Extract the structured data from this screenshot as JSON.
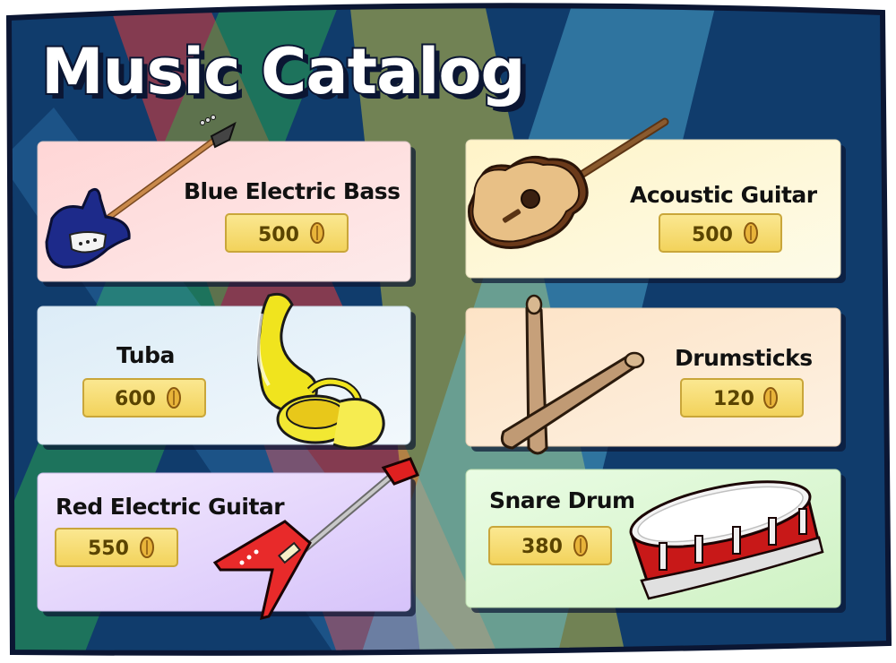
{
  "catalog": {
    "title": "Music Catalog",
    "items": [
      {
        "name": "Blue Electric Bass",
        "price": "500",
        "icon": "blue-electric-bass-icon",
        "bg": "#fde0e0"
      },
      {
        "name": "Acoustic Guitar",
        "price": "500",
        "icon": "acoustic-guitar-icon",
        "bg": "#fdf9dc"
      },
      {
        "name": "Tuba",
        "price": "600",
        "icon": "tuba-icon",
        "bg": "#e6f2fa"
      },
      {
        "name": "Drumsticks",
        "price": "120",
        "icon": "drumsticks-icon",
        "bg": "#fde9d2"
      },
      {
        "name": "Red Electric Guitar",
        "price": "550",
        "icon": "red-electric-guitar-icon",
        "bg": "#e6dcfb"
      },
      {
        "name": "Snare Drum",
        "price": "380",
        "icon": "snare-drum-icon",
        "bg": "#e4f9dc"
      }
    ]
  },
  "colors": {
    "background": "#103c6c",
    "price_tag": "#f7dc70",
    "coin": "#e8b43a",
    "spotlights": [
      "#e33b3b",
      "#2fb54a",
      "#e8d838",
      "#5ec8ee"
    ]
  }
}
